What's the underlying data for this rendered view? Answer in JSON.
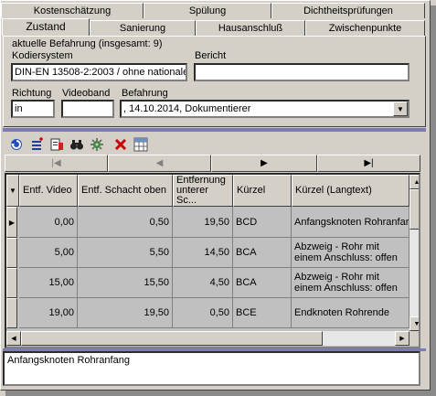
{
  "tabs_back": [
    {
      "label": "Kostenschätzung"
    },
    {
      "label": "Spülung"
    },
    {
      "label": "Dichtheitsprüfungen"
    }
  ],
  "tabs_front": [
    {
      "label": "Zustand",
      "active": true
    },
    {
      "label": "Sanierung"
    },
    {
      "label": "Hausanschluß"
    },
    {
      "label": "Zwischenpunkte"
    }
  ],
  "group_label": "aktuelle Befahrung (insgesamt: 9)",
  "fields": {
    "kodiersystem_label": "Kodiersystem",
    "kodiersystem_value": "DIN-EN 13508-2:2003 / ohne nationale",
    "bericht_label": "Bericht",
    "bericht_value": "",
    "richtung_label": "Richtung",
    "richtung_value": "in",
    "videoband_label": "Videoband",
    "videoband_value": "",
    "befahrung_label": "Befahrung",
    "befahrung_value": ", 14.10.2014, Dokumentierer"
  },
  "toolbar": [
    "refresh-icon",
    "insert-icon",
    "edit-icon",
    "binoculars-icon",
    "settings-icon",
    "delete-icon",
    "grid-icon"
  ],
  "colors": {
    "delete": "#cc0000",
    "separator": "#7b7bb5"
  },
  "columns": [
    "Entf. Video",
    "Entf. Schacht oben",
    "Entfernung unterer Sc...",
    "Kürzel",
    "Kürzel (Langtext)"
  ],
  "rows": [
    {
      "video": "0,00",
      "schacht": "0,50",
      "unten": "19,50",
      "kuerzel": "BCD",
      "lang": "Anfangsknoten Rohranfar",
      "current": true
    },
    {
      "video": "5,00",
      "schacht": "5,50",
      "unten": "14,50",
      "kuerzel": "BCA",
      "lang": "Abzweig - Rohr mit einem Anschluss: offen"
    },
    {
      "video": "15,00",
      "schacht": "15,50",
      "unten": "4,50",
      "kuerzel": "BCA",
      "lang": "Abzweig - Rohr mit einem Anschluss: offen"
    },
    {
      "video": "19,00",
      "schacht": "19,50",
      "unten": "0,50",
      "kuerzel": "BCE",
      "lang": "Endknoten Rohrende"
    }
  ],
  "memo_text": "Anfangsknoten Rohranfang"
}
